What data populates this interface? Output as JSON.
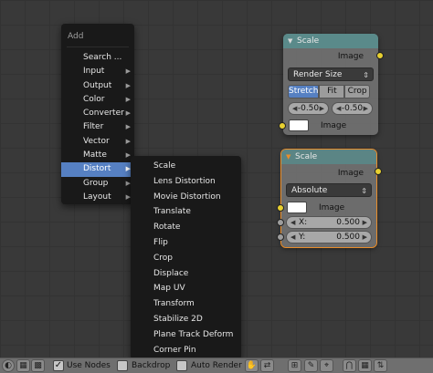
{
  "add_menu": {
    "title": "Add",
    "items": [
      {
        "label": "Search ...",
        "has_submenu": false
      },
      {
        "label": "Input",
        "has_submenu": true
      },
      {
        "label": "Output",
        "has_submenu": true
      },
      {
        "label": "Color",
        "has_submenu": true
      },
      {
        "label": "Converter",
        "has_submenu": true
      },
      {
        "label": "Filter",
        "has_submenu": true
      },
      {
        "label": "Vector",
        "has_submenu": true
      },
      {
        "label": "Matte",
        "has_submenu": true
      },
      {
        "label": "Distort",
        "has_submenu": true,
        "active": true
      },
      {
        "label": "Group",
        "has_submenu": true
      },
      {
        "label": "Layout",
        "has_submenu": true
      }
    ]
  },
  "distort_submenu": {
    "items": [
      "Scale",
      "Lens Distortion",
      "Movie Distortion",
      "Translate",
      "Rotate",
      "Flip",
      "Crop",
      "Displace",
      "Map UV",
      "Transform",
      "Stabilize 2D",
      "Plane Track Deform",
      "Corner Pin"
    ]
  },
  "node1": {
    "title": "Scale",
    "output_label": "Image",
    "mode": "Render Size",
    "fit_options": [
      "Stretch",
      "Fit",
      "Crop"
    ],
    "fit_selected": "Stretch",
    "offset_x": "-0.50",
    "offset_y": "-0.50",
    "input_label": "Image"
  },
  "node2": {
    "title": "Scale",
    "output_label": "Image",
    "mode": "Absolute",
    "input_label": "Image",
    "x_label": "X:",
    "x_value": "0.500",
    "y_label": "Y:",
    "y_value": "0.500"
  },
  "bottombar": {
    "use_nodes_label": "Use Nodes",
    "use_nodes_checked": true,
    "backdrop_label": "Backdrop",
    "backdrop_checked": false,
    "auto_render_label": "Auto Render",
    "auto_render_checked": false
  },
  "colors": {
    "menu_bg": "#191919",
    "highlight": "#5680c2",
    "node_header": "#5a8a8a",
    "node_body": "#707070",
    "socket_image": "#e8d030",
    "socket_value": "#9e9e9e",
    "selection_outline": "#e98d2a"
  }
}
